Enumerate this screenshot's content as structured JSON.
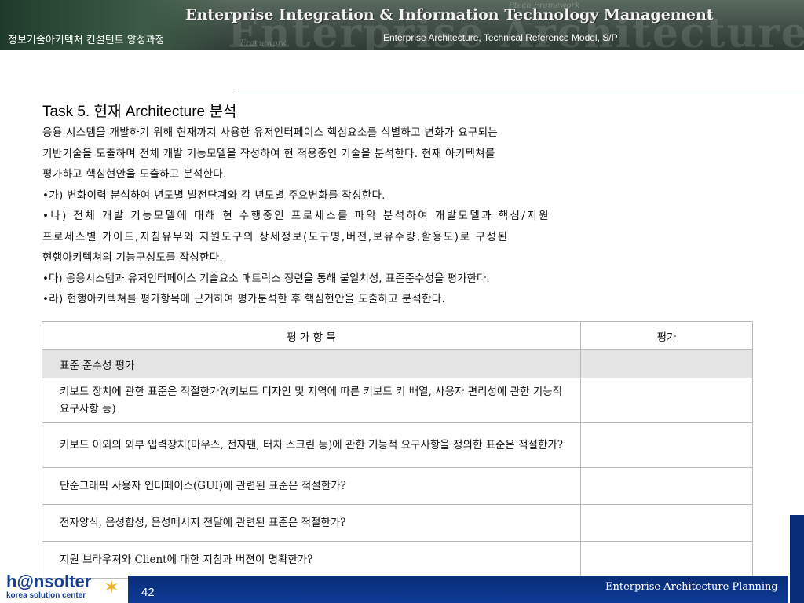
{
  "header": {
    "title": "Enterprise Integration & Information Technology Management",
    "course": "정보기술아키텍처 컨설턴트 양성과정",
    "subtitle": "Enterprise Architecture, Technical Reference Model, S/P",
    "watermark": "Enterprise Architecture Model",
    "watermark_small_1": "Ptech Framework",
    "watermark_small_2": "Framework"
  },
  "content": {
    "task_title": "Task 5. 현재 Architecture 분석",
    "lines": [
      "응용 시스템을 개발하기 위해 현재까지 사용한 유저인터페이스 핵심요소를 식별하고 변화가 요구되는",
      "기반기술을 도출하며 전체 개발 기능모델을 작성하여 현 적용중인 기술을 분석한다.  현재 아키텍쳐를",
      "평가하고 핵심현안을 도출하고 분석한다.",
      "•가)  변화이력 분석하여 년도별 발전단계와 각 년도별 주요변화를 작성한다.",
      "•나) 전체 개발 기능모델에 대해 현 수행중인 프로세스를 파악 분석하여 개발모델과 핵심/지원",
      "프로세스별 가이드,지침유무와  지원도구의 상세정보(도구명,버전,보유수량,활용도)로 구성된",
      "현행아키텍쳐의 기능구성도를 작성한다.",
      "•다)  응용시스템과 유저인터페이스 기술요소 매트릭스 정련을 통해 불일치성, 표준준수성을 평가한다.",
      "•라)  현행아키텍쳐를 평가항목에 근거하여 평가분석한 후 핵심현안을 도출하고 분석한다."
    ]
  },
  "table": {
    "headers": [
      "평 가 항 목",
      "평가"
    ],
    "group": "표준 준수성 평가",
    "rows": [
      "키보드 장치에 관한 표준은 적절한가?(키보드 디자인 및 지역에 따른 키보드 키 배열, 사용자 편리성에 관한 기능적 요구사항 등)",
      "키보드 이외의 외부 입력장치(마우스, 전자팬, 터치 스크린 등)에 관한 기능적 요구사항을 정의한 표준은 적절한가?",
      "단순그래픽 사용자 인터페이스(GUI)에 관련된 표준은 적절한가?",
      "전자양식, 음성합성, 음성메시지 전달에 관련된 표준은 적절한가?",
      "지원 브라우져와 Client에 대한 지침과 버젼이 명확한가?"
    ]
  },
  "footer": {
    "logo": "h@nsolter",
    "logo_sub": "korea solution center",
    "page_number": "42",
    "text": "Enterprise Architecture Planning"
  }
}
